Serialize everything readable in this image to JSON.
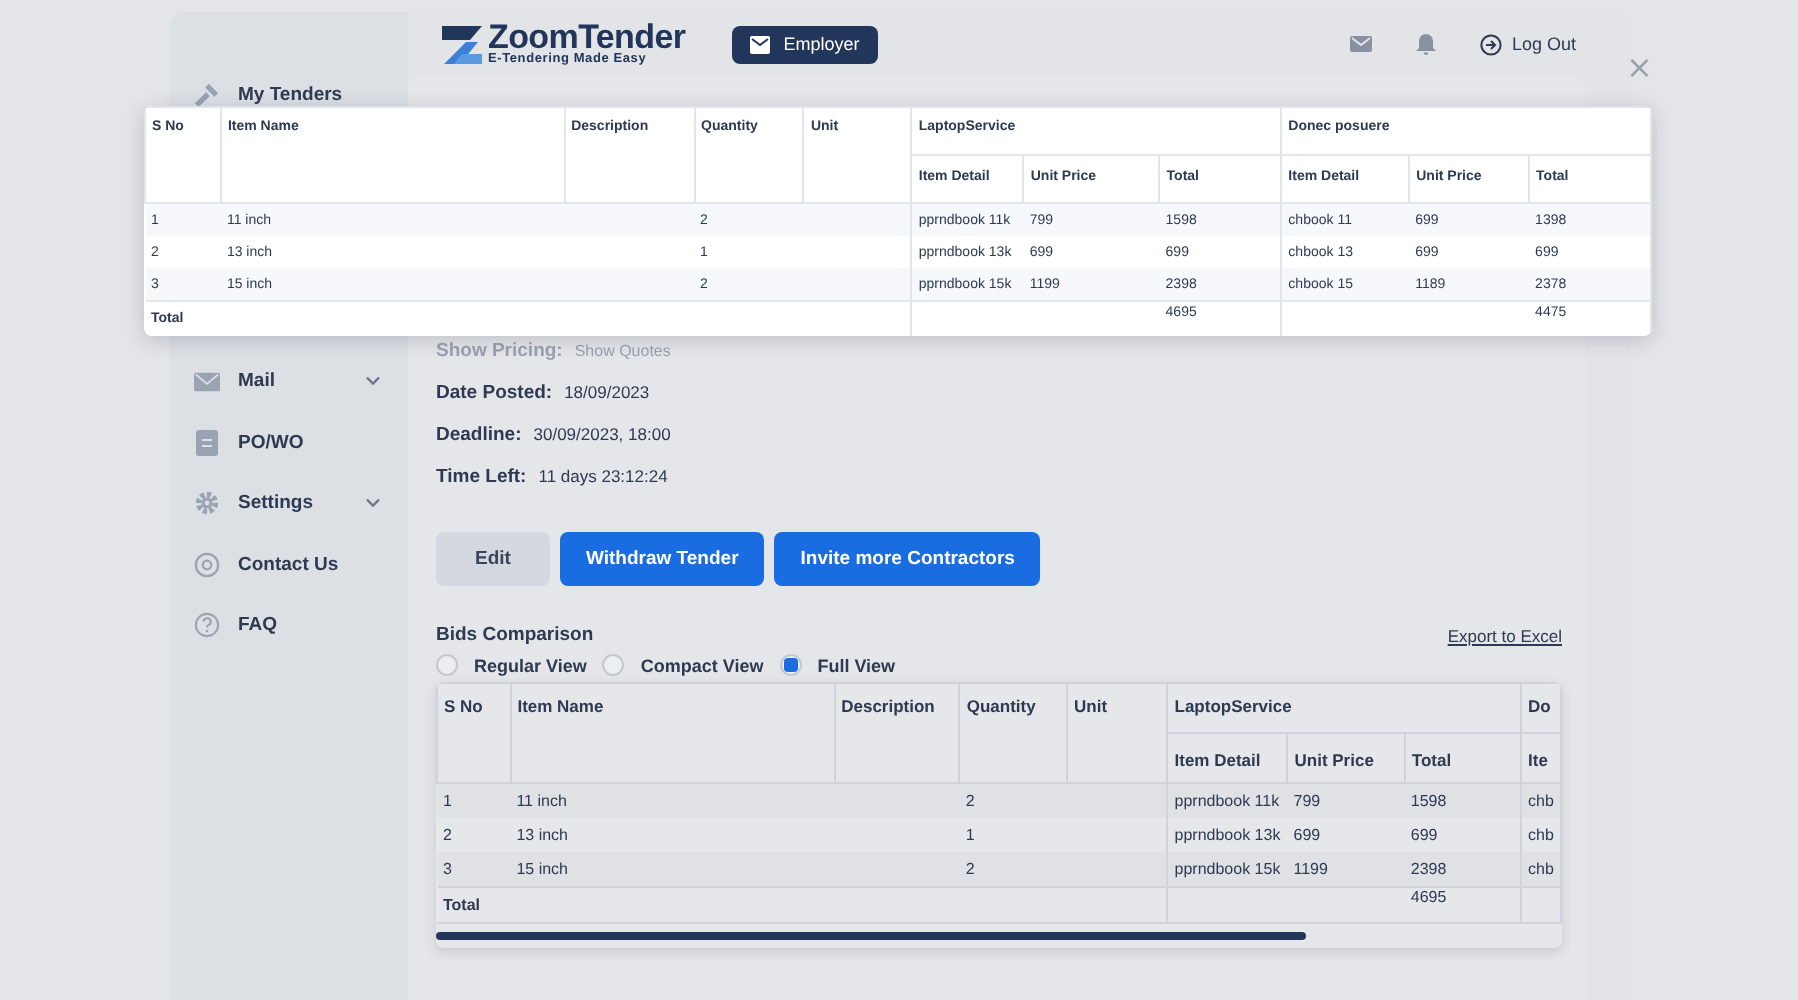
{
  "header": {
    "logo": {
      "name": "ZoomTender",
      "tagline": "E-Tendering Made Easy"
    },
    "role_button": "Employer",
    "logout": "Log Out"
  },
  "close_button": "×",
  "sidebar": {
    "items": [
      {
        "label": "My Tenders",
        "expandable": false
      },
      {
        "label": "Mail",
        "expandable": true
      },
      {
        "label": "PO/WO",
        "expandable": false
      },
      {
        "label": "Settings",
        "expandable": true
      },
      {
        "label": "Contact Us",
        "expandable": false
      },
      {
        "label": "FAQ",
        "expandable": false
      }
    ]
  },
  "details": [
    {
      "label": "Show Pricing:",
      "value": "Show Quotes"
    },
    {
      "label": "Date Posted:",
      "value": "18/09/2023"
    },
    {
      "label": "Deadline:",
      "value": "30/09/2023, 18:00"
    },
    {
      "label": "Time Left:",
      "value": "11 days 23:12:24"
    }
  ],
  "buttons": [
    {
      "label": "Edit",
      "kind": "secondary"
    },
    {
      "label": "Withdraw Tender",
      "kind": "primary"
    },
    {
      "label": "Invite more Contractors",
      "kind": "primary"
    }
  ],
  "bids": {
    "title": "Bids Comparison",
    "export_link": "Export to Excel",
    "views": [
      {
        "label": "Regular View",
        "selected": false
      },
      {
        "label": "Compact View",
        "selected": false
      },
      {
        "label": "Full View",
        "selected": true
      }
    ],
    "table": {
      "columns": [
        "S No",
        "Item Name",
        "Description",
        "Quantity",
        "Unit"
      ],
      "vendors": [
        {
          "name": "LaptopService",
          "columns": [
            "Item Detail",
            "Unit Price",
            "Total"
          ]
        },
        {
          "name": "Do",
          "columns": [
            "Ite"
          ]
        }
      ],
      "rows": [
        {
          "s_no": "1",
          "item_name": "11 inch",
          "quantity": "2",
          "vendors": [
            [
              "pprndbook 11k",
              "799",
              "1598"
            ],
            [
              "chb"
            ]
          ]
        },
        {
          "s_no": "2",
          "item_name": "13 inch",
          "quantity": "1",
          "vendors": [
            [
              "pprndbook 13k",
              "699",
              "699"
            ],
            [
              "chb"
            ]
          ]
        },
        {
          "s_no": "3",
          "item_name": "15 inch",
          "quantity": "2",
          "vendors": [
            [
              "pprndbook 15k",
              "1199",
              "2398"
            ],
            [
              "chb"
            ]
          ]
        }
      ],
      "total": {
        "label": "Total",
        "vendor_totals": [
          "4695"
        ]
      }
    }
  },
  "popup_table": {
    "columns": [
      "S No",
      "Item Name",
      "Description",
      "Quantity",
      "Unit"
    ],
    "vendors": [
      {
        "name": "LaptopService",
        "columns": [
          "Item Detail",
          "Unit Price",
          "Total"
        ]
      },
      {
        "name": "Donec posuere",
        "columns": [
          "Item Detail",
          "Unit Price",
          "Total"
        ]
      }
    ],
    "rows": [
      {
        "s_no": "1",
        "item_name": "11 inch",
        "quantity": "2",
        "vendors": [
          [
            "pprndbook 11k",
            "799",
            "1598"
          ],
          [
            "chbook 11",
            "699",
            "1398"
          ]
        ]
      },
      {
        "s_no": "2",
        "item_name": "13 inch",
        "quantity": "1",
        "vendors": [
          [
            "pprndbook 13k",
            "699",
            "699"
          ],
          [
            "chbook 13",
            "699",
            "699"
          ]
        ]
      },
      {
        "s_no": "3",
        "item_name": "15 inch",
        "quantity": "2",
        "vendors": [
          [
            "pprndbook 15k",
            "1199",
            "2398"
          ],
          [
            "chbook 15",
            "1189",
            "2378"
          ]
        ]
      }
    ],
    "total": {
      "label": "Total",
      "vendor_totals": [
        "4695",
        "4475"
      ]
    }
  }
}
